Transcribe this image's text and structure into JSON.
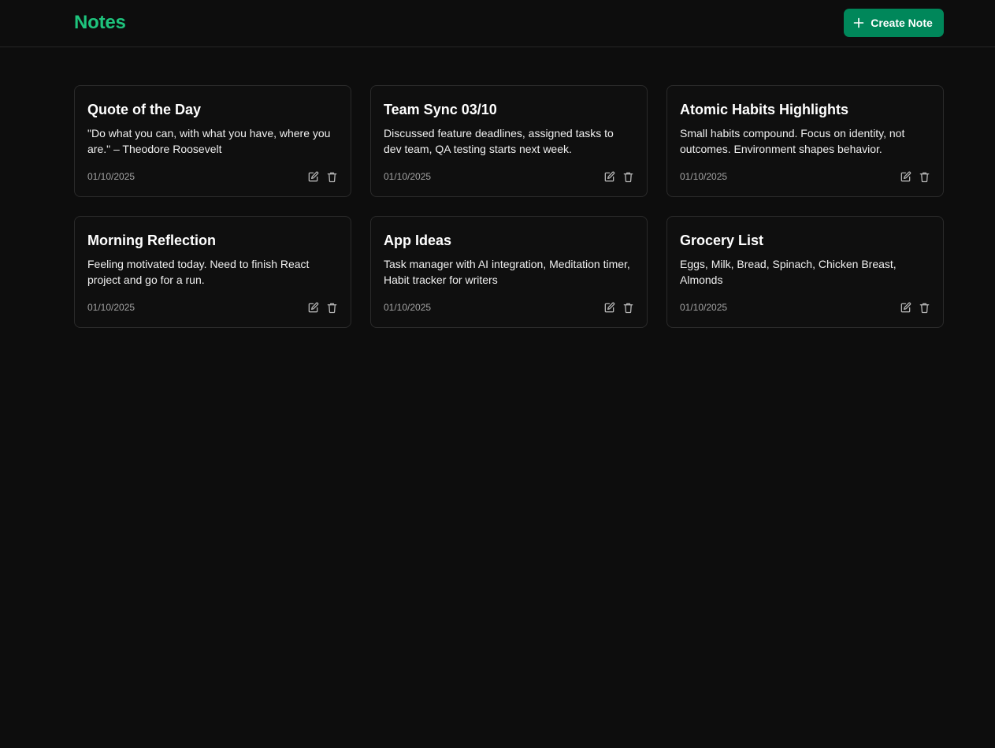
{
  "app": {
    "title": "Notes",
    "accent_color": "#1ec47d",
    "button_color": "#00875a"
  },
  "header": {
    "create_label": "Create Note",
    "create_icon": "plus-icon"
  },
  "notes": [
    {
      "title": "Quote of the Day",
      "body": "\"Do what you can, with what you have, where you are.\" – Theodore Roosevelt",
      "date": "01/10/2025"
    },
    {
      "title": "Team Sync 03/10",
      "body": "Discussed feature deadlines, assigned tasks to dev team, QA testing starts next week.",
      "date": "01/10/2025"
    },
    {
      "title": "Atomic Habits Highlights",
      "body": "Small habits compound. Focus on identity, not outcomes. Environment shapes behavior.",
      "date": "01/10/2025"
    },
    {
      "title": "Morning Reflection",
      "body": "Feeling motivated today. Need to finish React project and go for a run.",
      "date": "01/10/2025"
    },
    {
      "title": "App Ideas",
      "body": "Task manager with AI integration, Meditation timer, Habit tracker for writers",
      "date": "01/10/2025"
    },
    {
      "title": "Grocery List",
      "body": "Eggs, Milk, Bread, Spinach, Chicken Breast, Almonds",
      "date": "01/10/2025"
    }
  ],
  "icons": {
    "edit": "edit-icon",
    "delete": "trash-icon"
  }
}
